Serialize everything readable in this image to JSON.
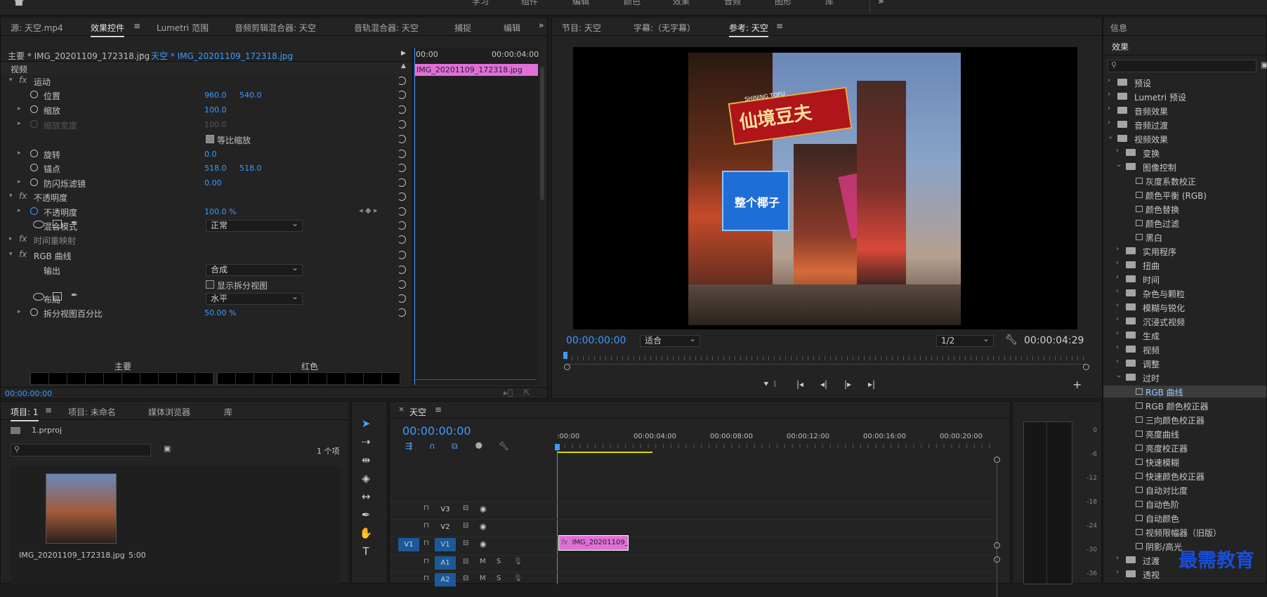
{
  "topbar": {
    "workspaces": [
      "学习",
      "组件",
      "编辑",
      "颜色",
      "效果",
      "音频",
      "图形",
      "库"
    ],
    "more": "»"
  },
  "effect_controls": {
    "tabs": [
      "源: 天空.mp4",
      "效果控件",
      "Lumetri 范围",
      "音频剪辑混合器: 天空",
      "音轨混合器: 天空",
      "捕捉",
      "编辑"
    ],
    "master_label": "主要 * IMG_20201109_172318.jpg",
    "clip_label": "天空 * IMG_20201109_172318.jpg",
    "section_video": "视频",
    "rows": [
      {
        "label": "运动",
        "kind": "fx"
      },
      {
        "label": "位置",
        "v1": "960.0",
        "v2": "540.0"
      },
      {
        "label": "缩放",
        "v1": "100.0"
      },
      {
        "label": "缩放宽度",
        "v1": "100.0",
        "disabled": true
      },
      {
        "label": "等比缩放",
        "kind": "check"
      },
      {
        "label": "旋转",
        "v1": "0.0"
      },
      {
        "label": "锚点",
        "v1": "518.0",
        "v2": "518.0"
      },
      {
        "label": "防闪烁滤镜",
        "v1": "0.00"
      },
      {
        "label": "不透明度",
        "kind": "fx"
      },
      {
        "label": "不透明度",
        "v1": "100.0 %"
      },
      {
        "label": "混合模式",
        "dropdown": "正常"
      },
      {
        "label": "时间重映射",
        "kind": "fx"
      },
      {
        "label": "RGB 曲线",
        "kind": "fx"
      },
      {
        "label": "输出",
        "dropdown": "合成"
      },
      {
        "label": "显示拆分视图",
        "kind": "check"
      },
      {
        "label": "布局",
        "dropdown": "水平"
      },
      {
        "label": "拆分视图百分比",
        "v1": "50.00 %"
      }
    ],
    "curve_main": "主要",
    "curve_red": "红色",
    "timecode": "00:00:00:00",
    "mini_timeline": {
      "t0": "00:00",
      "t1": "00:00:04:00",
      "clip": "IMG_20201109_172318.jpg"
    }
  },
  "program": {
    "tabs": [
      "节目: 天空",
      "字幕:（无字幕）",
      "参考: 天空"
    ],
    "timecode": "00:00:00:00",
    "fit": "适合",
    "res": "1/2",
    "duration": "00:00:04:29",
    "neon_sign": "仙境豆夫",
    "neon_sub": "SHINING TOFU",
    "blue_sign": "整个椰子"
  },
  "effects": {
    "tabs": [
      "信息",
      "效果"
    ],
    "items": [
      {
        "label": "预设",
        "level": 0,
        "type": "folder",
        "open": false
      },
      {
        "label": "Lumetri 预设",
        "level": 0,
        "type": "folder",
        "open": false
      },
      {
        "label": "音频效果",
        "level": 0,
        "type": "folder",
        "open": false
      },
      {
        "label": "音频过渡",
        "level": 0,
        "type": "folder",
        "open": false
      },
      {
        "label": "视频效果",
        "level": 0,
        "type": "folder",
        "open": true
      },
      {
        "label": "变换",
        "level": 1,
        "type": "folder",
        "open": false
      },
      {
        "label": "图像控制",
        "level": 1,
        "type": "folder",
        "open": true
      },
      {
        "label": "灰度系数校正",
        "level": 2,
        "type": "fx"
      },
      {
        "label": "颜色平衡 (RGB)",
        "level": 2,
        "type": "fx"
      },
      {
        "label": "颜色替换",
        "level": 2,
        "type": "fx"
      },
      {
        "label": "颜色过滤",
        "level": 2,
        "type": "fx"
      },
      {
        "label": "黑白",
        "level": 2,
        "type": "fx"
      },
      {
        "label": "实用程序",
        "level": 1,
        "type": "folder",
        "open": false
      },
      {
        "label": "扭曲",
        "level": 1,
        "type": "folder",
        "open": false
      },
      {
        "label": "时间",
        "level": 1,
        "type": "folder",
        "open": false
      },
      {
        "label": "杂色与颗粒",
        "level": 1,
        "type": "folder",
        "open": false
      },
      {
        "label": "模糊与锐化",
        "level": 1,
        "type": "folder",
        "open": false
      },
      {
        "label": "沉浸式视频",
        "level": 1,
        "type": "folder",
        "open": false
      },
      {
        "label": "生成",
        "level": 1,
        "type": "folder",
        "open": false
      },
      {
        "label": "视频",
        "level": 1,
        "type": "folder",
        "open": false
      },
      {
        "label": "调整",
        "level": 1,
        "type": "folder",
        "open": false
      },
      {
        "label": "过时",
        "level": 1,
        "type": "folder",
        "open": true
      },
      {
        "label": "RGB 曲线",
        "level": 2,
        "type": "fx",
        "selected": true
      },
      {
        "label": "RGB 颜色校正器",
        "level": 2,
        "type": "fx"
      },
      {
        "label": "三向颜色校正器",
        "level": 2,
        "type": "fx"
      },
      {
        "label": "亮度曲线",
        "level": 2,
        "type": "fx"
      },
      {
        "label": "亮度校正器",
        "level": 2,
        "type": "fx"
      },
      {
        "label": "快速模糊",
        "level": 2,
        "type": "fx"
      },
      {
        "label": "快速颜色校正器",
        "level": 2,
        "type": "fx"
      },
      {
        "label": "自动对比度",
        "level": 2,
        "type": "fx"
      },
      {
        "label": "自动色阶",
        "level": 2,
        "type": "fx"
      },
      {
        "label": "自动颜色",
        "level": 2,
        "type": "fx"
      },
      {
        "label": "视频限幅器（旧版）",
        "level": 2,
        "type": "fx"
      },
      {
        "label": "阴影/高光",
        "level": 2,
        "type": "fx"
      },
      {
        "label": "过渡",
        "level": 1,
        "type": "folder",
        "open": false
      },
      {
        "label": "透视",
        "level": 1,
        "type": "folder",
        "open": false
      }
    ]
  },
  "project": {
    "tabs": [
      "项目: 1",
      "项目: 未命名",
      "媒体浏览器",
      "库"
    ],
    "file": "1.prproj",
    "count": "1 个项",
    "clip_name": "IMG_20201109_172318.jpg",
    "clip_dur": "5:00"
  },
  "timeline": {
    "title": "天空",
    "timecode": "00:00:00:00",
    "ruler": [
      ":00:00",
      "00:00:04:00",
      "00:00:08:00",
      "00:00:12:00",
      "00:00:16:00",
      "00:00:20:00"
    ],
    "tracks": [
      "V3",
      "V2",
      "V1",
      "A1",
      "A2"
    ],
    "clip": "IMG_20201109_172318"
  },
  "meter": {
    "labels": [
      "0",
      "-6",
      "-12",
      "-18",
      "-24",
      "-30",
      "-36"
    ]
  },
  "watermark": "最需教育"
}
